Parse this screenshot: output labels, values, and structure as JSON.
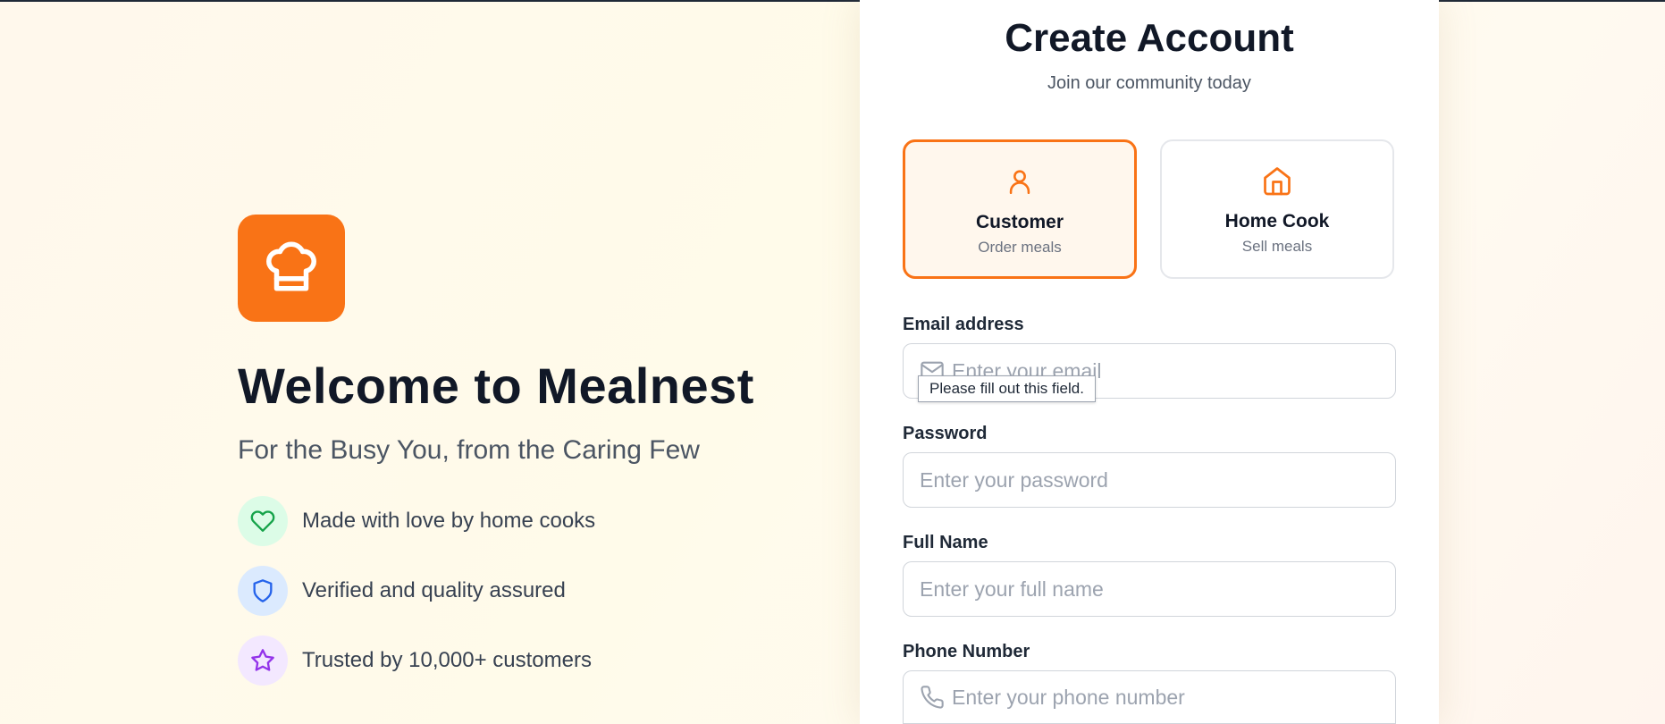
{
  "hero": {
    "title": "Welcome to Mealnest",
    "subtitle": "For the Busy You, from the Caring Few",
    "logo_icon": "chef-hat-icon",
    "features": [
      {
        "icon": "heart-icon",
        "color": "#16a34a",
        "text": "Made with love by home cooks"
      },
      {
        "icon": "shield-icon",
        "color": "#2563eb",
        "text": "Verified and quality assured"
      },
      {
        "icon": "star-icon",
        "color": "#9333ea",
        "text": "Trusted by 10,000+ customers"
      }
    ]
  },
  "form": {
    "title": "Create Account",
    "subtitle": "Join our community today",
    "roles": [
      {
        "title": "Customer",
        "desc": "Order meals",
        "icon": "user-icon",
        "selected": true
      },
      {
        "title": "Home Cook",
        "desc": "Sell meals",
        "icon": "home-icon",
        "selected": false
      }
    ],
    "email": {
      "label": "Email address",
      "placeholder": "Enter your email",
      "value": "",
      "icon": "mail-icon"
    },
    "password": {
      "label": "Password",
      "placeholder": "Enter your password",
      "value": ""
    },
    "full_name": {
      "label": "Full Name",
      "placeholder": "Enter your full name",
      "value": ""
    },
    "phone": {
      "label": "Phone Number",
      "placeholder": "Enter your phone number",
      "value": "",
      "icon": "phone-icon"
    },
    "validation_tooltip": "Please fill out this field."
  },
  "colors": {
    "accent": "#f97316",
    "heading": "#111827",
    "muted": "#6b7280"
  }
}
